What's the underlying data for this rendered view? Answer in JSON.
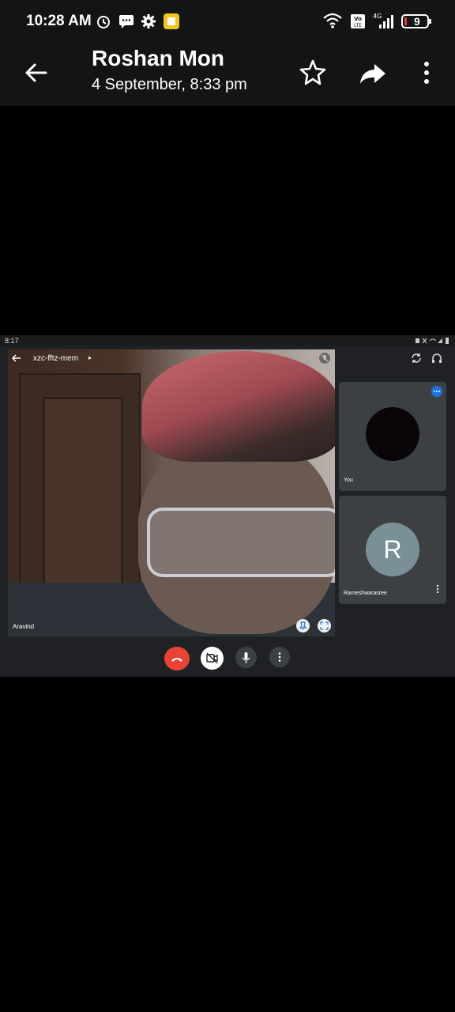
{
  "status_bar": {
    "time": "10:28 AM",
    "battery": "9",
    "network": "4G"
  },
  "header": {
    "title": "Roshan Mon",
    "subtitle": "4 September, 8:33 pm"
  },
  "meet": {
    "status_time": "8:17",
    "meeting_code": "xzc-fftz-mem",
    "main_video_name": "Aravind",
    "tiles": [
      {
        "name": "You"
      },
      {
        "name": "Rameshwarasree",
        "initial": "R"
      }
    ]
  },
  "colors": {
    "end_call": "#ea4335",
    "tile_bg": "#3c4043",
    "avatar_r": "#7b8f97",
    "badge_blue": "#1a73e8"
  }
}
